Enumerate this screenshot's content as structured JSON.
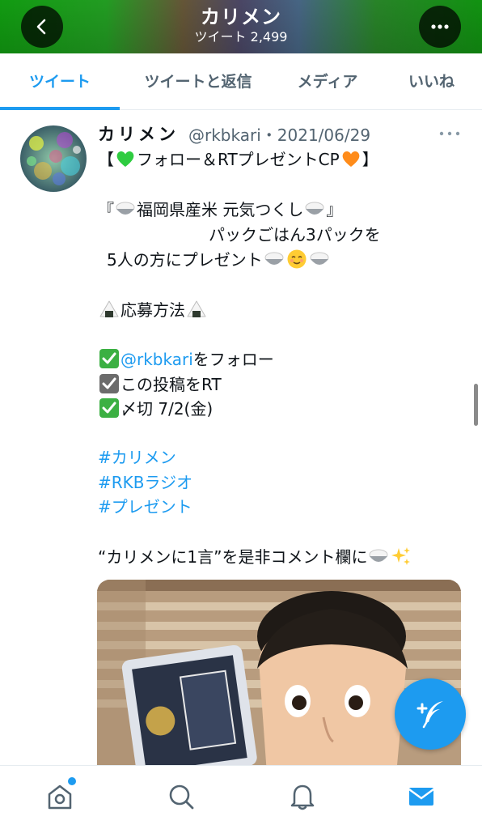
{
  "header": {
    "title": "カリメン",
    "subtitle": "ツイート 2,499",
    "back_icon": "chevron-left-icon",
    "more_icon": "more-horizontal-icon"
  },
  "tabs": [
    {
      "label": "ツイート",
      "active": true
    },
    {
      "label": "ツイートと返信",
      "active": false
    },
    {
      "label": "メディア",
      "active": false
    },
    {
      "label": "いいね",
      "active": false
    }
  ],
  "tweet": {
    "name": "カリメン",
    "handle": "@rkbkari・2021/06/29",
    "line1_open": "【",
    "line1_text": "フォロー＆RTプレゼントCP",
    "line1_close": "】",
    "line2_open": "『",
    "line2_text": "福岡県産米 元気つくし",
    "line2_close": "』",
    "line3": "パックごはん3パックを",
    "line4": "5人の方にプレゼント",
    "line5": "応募方法",
    "step1_mention": "@rkbkari",
    "step1_text": "をフォロー",
    "step2": "この投稿をRT",
    "step3": "〆切 7/2(金)",
    "hashtags": [
      "#カリメン",
      "#RKBラジオ",
      "#プレゼント"
    ],
    "closing": "“カリメンに1言”を是非コメント欄に",
    "colors": {
      "green_heart": "#2ecc40",
      "orange_heart": "#ff8c1a",
      "check_green": "#3cb043",
      "check_gray": "#6b6b6b"
    }
  },
  "fab": {
    "icon": "compose-tweet-icon"
  },
  "bottom_nav": [
    {
      "icon": "home-icon",
      "has_badge": true
    },
    {
      "icon": "search-icon"
    },
    {
      "icon": "notifications-bell-icon"
    },
    {
      "icon": "messages-mail-icon"
    }
  ],
  "accent": "#1d9bf0"
}
